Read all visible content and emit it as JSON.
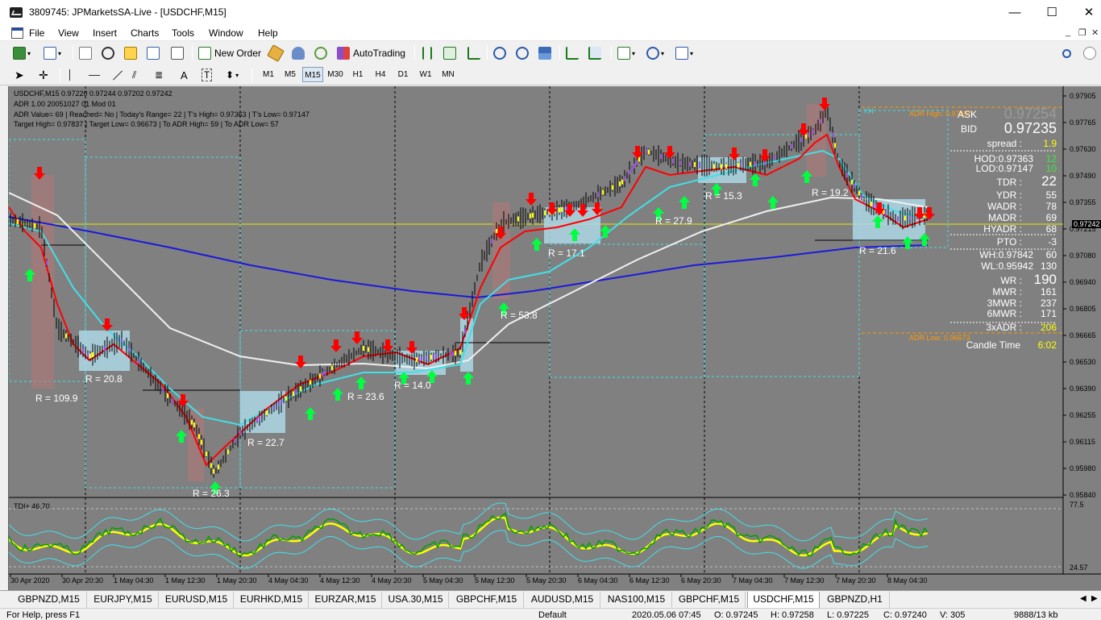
{
  "window": {
    "title": "3809745: JPMarketsSA-Live - [USDCHF,M15]",
    "minimize": "—",
    "maximize": "☐",
    "close": "✕"
  },
  "menu": {
    "items": [
      "File",
      "View",
      "Insert",
      "Charts",
      "Tools",
      "Window",
      "Help"
    ],
    "mdi_minimize": "_",
    "mdi_restore": "❐",
    "mdi_close": "✕"
  },
  "toolbar": {
    "new_order": "New Order",
    "autotrading": "AutoTrading",
    "timeframes": [
      "M1",
      "M5",
      "M15",
      "M30",
      "H1",
      "H4",
      "D1",
      "W1",
      "MN"
    ],
    "active_timeframe": "M15"
  },
  "chart": {
    "symbol_line": "USDCHF,M15  0.97220 0.97244 0.97202 0.97242",
    "adr_line": "ADR 1.00 20051027 01 Mod 01",
    "info_line1": "ADR Value= 69   | Reached= No   | Today's Range= 22   | T's High= 0.97363   | T's Low= 0.97147",
    "info_line2": "Target High= 0.97837   | Target Low= 0.96673   | To ADR High= 59   | To ADR Low= 57",
    "adr_high_label": "ADR High: 0.97837",
    "adr_low_label": "ADR Low: 0.96673",
    "yh_label": "YH",
    "current_price_tag": "0.97242",
    "price_ticks": [
      "0.97905",
      "0.97765",
      "0.97630",
      "0.97490",
      "0.97355",
      "0.97215",
      "0.97080",
      "0.96940",
      "0.96805",
      "0.96665",
      "0.96530",
      "0.96390",
      "0.96255",
      "0.96115",
      "0.95980",
      "0.95840"
    ],
    "time_ticks": [
      "30 Apr 2020",
      "30 Apr 20:30",
      "1 May 04:30",
      "1 May 12:30",
      "1 May 20:30",
      "4 May 04:30",
      "4 May 12:30",
      "4 May 20:30",
      "5 May 04:30",
      "5 May 12:30",
      "5 May 20:30",
      "6 May 04:30",
      "6 May 12:30",
      "6 May 20:30",
      "7 May 04:30",
      "7 May 12:30",
      "7 May 20:30",
      "8 May 04:30"
    ],
    "range_labels": [
      "R = 109.9",
      "R = 20.8",
      "R = 26.3",
      "R = 22.7",
      "R = 23.6",
      "R = 14.0",
      "R = 53.8",
      "R = 17.1",
      "R = 27.9",
      "R = 15.3",
      "R = 19.2",
      "R = 21.6"
    ],
    "tdi_label": "TDI+ 46.70",
    "tdi_ticks": [
      "77.5",
      "24.57"
    ]
  },
  "panel": {
    "ask_label": "ASK",
    "ask_value": "0.97254",
    "bid_label": "BID",
    "bid_value": "0.97235",
    "spread_label": "spread :",
    "spread_value": "1.9",
    "hod_label": "HOD:0.97363",
    "hod_value": "12",
    "lod_label": "LOD:0.97147",
    "lod_value": "10",
    "tdr_label": "TDR :",
    "tdr_value": "22",
    "ydr_label": "YDR :",
    "ydr_value": "55",
    "wadr_label": "WADR :",
    "wadr_value": "78",
    "madr_label": "MADR :",
    "madr_value": "69",
    "hyadr_label": "HYADR :",
    "hyadr_value": "68",
    "pto_label": "PTO :",
    "pto_value": "-3",
    "wh_label": "WH:0.97842",
    "wh_value": "60",
    "wl_label": "WL:0.95942",
    "wl_value": "130",
    "wr_label": "WR :",
    "wr_value": "190",
    "mwr_label": "MWR :",
    "mwr_value": "161",
    "mwr3_label": "3MWR :",
    "mwr3_value": "237",
    "mwr6_label": "6MWR :",
    "mwr6_value": "171",
    "adr3_label": "3xADR :",
    "adr3_value": "206",
    "candle_label": "Candle Time",
    "candle_value": "6:02"
  },
  "tabs": [
    "GBPNZD,M15",
    "EURJPY,M15",
    "EURUSD,M15",
    "EURHKD,M15",
    "EURZAR,M15",
    "USA.30,M15",
    "GBPCHF,M15",
    "AUDUSD,M15",
    "NAS100,M15",
    "GBPCHF,M15",
    "USDCHF,M15",
    "GBPNZD,H1"
  ],
  "active_tab": "USDCHF,M15",
  "status": {
    "help": "For Help, press F1",
    "profile": "Default",
    "datetime": "2020.05.06 07:45",
    "open": "O: 0.97245",
    "high": "H: 0.97258",
    "low": "L: 0.97225",
    "close": "C: 0.97240",
    "volume": "V: 305",
    "traffic": "9888/13 kb"
  },
  "colors": {
    "chart_bg": "#808080",
    "ema_fast": "#ff0000",
    "ema_mid": "#40e0e8",
    "ema_white": "#f0f0f0",
    "ema_slow": "#1a1adc",
    "up_arrow": "#00ff40",
    "down_arrow": "#ff0000",
    "adr_line": "#ff9900",
    "tdi_green": "#00a000",
    "tdi_yellow": "#ffff00"
  }
}
